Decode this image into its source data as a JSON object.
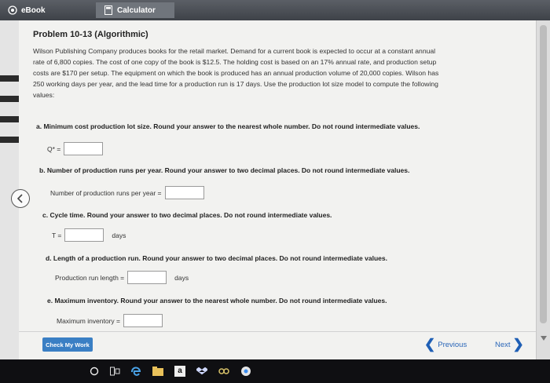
{
  "tabs": [
    {
      "label": "eBook",
      "icon": "ebook-icon"
    },
    {
      "label": "Calculator",
      "icon": "calculator-icon"
    }
  ],
  "problem": {
    "title": "Problem 10-13 (Algorithmic)",
    "intro_lines": [
      "Wilson Publishing Company produces books for the retail market. Demand for a current book is expected to occur at a constant annual",
      "rate of 6,800 copies. The cost of one copy of the book is $12.5. The holding cost is based on an 17% annual rate, and production setup",
      "costs are $170 per setup. The equipment on which the book is produced has an annual production volume of 20,000 copies. Wilson has",
      "250 working days per year, and the lead time for a production run is 17 days. Use the production lot size model to compute the following",
      "values:"
    ]
  },
  "questions": {
    "a": {
      "text": "a. Minimum cost production lot size. Round your answer to the nearest whole number. Do not round intermediate values.",
      "field_label": "Q* =",
      "value": "",
      "unit": ""
    },
    "b": {
      "text": "b. Number of production runs per year. Round your answer to two decimal places. Do not round intermediate values.",
      "field_label": "Number of production runs per year =",
      "value": "",
      "unit": ""
    },
    "c": {
      "text": "c. Cycle time. Round your answer to two decimal places. Do not round intermediate values.",
      "field_label": "T =",
      "value": "",
      "unit": "days"
    },
    "d": {
      "text": "d. Length of a production run. Round your answer to two decimal places. Do not round intermediate values.",
      "field_label": "Production run length =",
      "value": "",
      "unit": "days"
    },
    "e": {
      "text": "e. Maximum inventory. Round your answer to the nearest whole number. Do not round intermediate values.",
      "field_label": "Maximum inventory =",
      "value": "",
      "unit": ""
    }
  },
  "footer": {
    "check_label": "Check My Work",
    "previous_label": "Previous",
    "next_label": "Next"
  },
  "taskbar": {
    "items": [
      "search-icon",
      "task-view-icon",
      "edge-icon",
      "file-explorer-icon",
      "amazon-icon",
      "dropbox-icon",
      "app-icon",
      "chrome-icon"
    ],
    "amazon_letter": "a"
  },
  "colors": {
    "accent": "#3a7fc4",
    "link": "#2a66b8",
    "tabbar": "#4a4e55",
    "taskbar": "#0f0f12"
  }
}
